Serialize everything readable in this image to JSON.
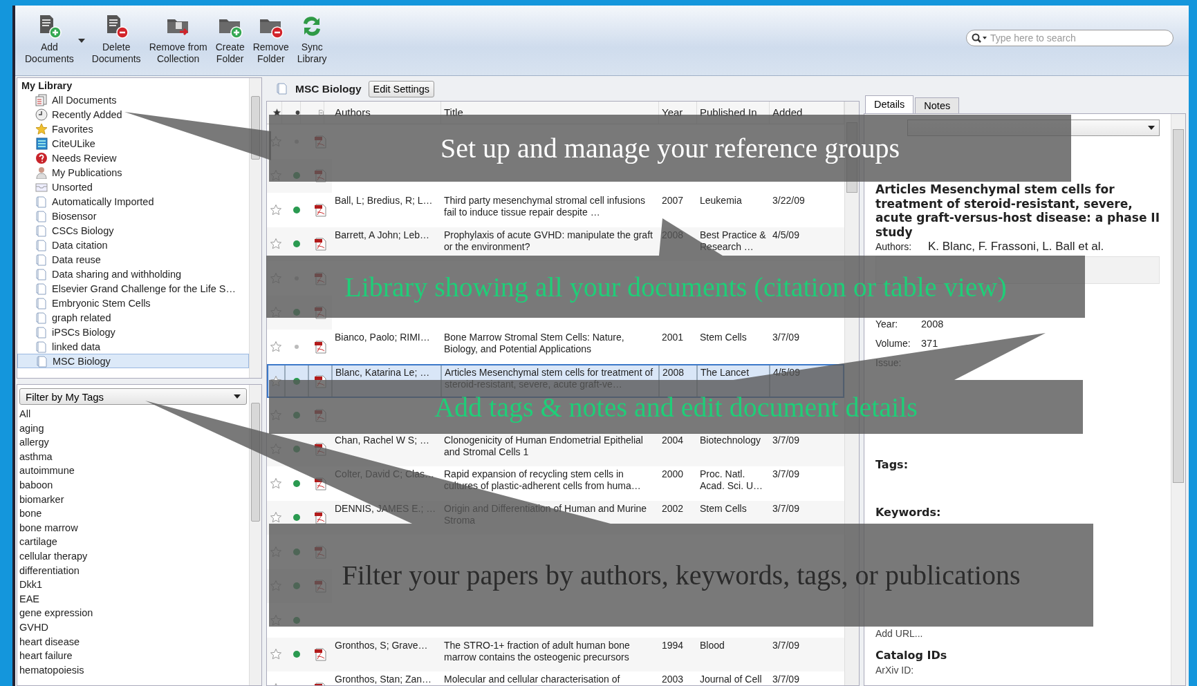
{
  "toolbar": {
    "buttons": [
      {
        "kind": "add-doc",
        "label": "Add\nDocuments",
        "has_menu": true
      },
      {
        "kind": "delete-doc",
        "label": "Delete\nDocuments",
        "has_menu": false
      },
      {
        "kind": "remove-collection",
        "label": "Remove from\nCollection",
        "has_menu": false
      },
      {
        "kind": "create-folder",
        "label": "Create\nFolder",
        "has_menu": false
      },
      {
        "kind": "remove-folder",
        "label": "Remove\nFolder",
        "has_menu": false
      },
      {
        "kind": "sync",
        "label": "Sync\nLibrary",
        "has_menu": false
      }
    ],
    "search": {
      "placeholder": "Type here to search"
    }
  },
  "library": {
    "title": "My Library",
    "items": [
      {
        "kind": "all",
        "label": "All Documents",
        "selected": false
      },
      {
        "kind": "recent",
        "label": "Recently Added",
        "selected": false
      },
      {
        "kind": "favorites",
        "label": "Favorites",
        "selected": false
      },
      {
        "kind": "citeulike",
        "label": "CiteULike",
        "selected": false
      },
      {
        "kind": "review",
        "label": "Needs Review",
        "selected": false
      },
      {
        "kind": "publications",
        "label": "My Publications",
        "selected": false
      },
      {
        "kind": "unsorted",
        "label": "Unsorted",
        "selected": false
      },
      {
        "kind": "folder",
        "label": "Automatically Imported",
        "selected": false
      },
      {
        "kind": "folder",
        "label": "Biosensor",
        "selected": false
      },
      {
        "kind": "folder",
        "label": "CSCs Biology",
        "selected": false
      },
      {
        "kind": "folder",
        "label": "Data citation",
        "selected": false
      },
      {
        "kind": "folder",
        "label": "Data reuse",
        "selected": false
      },
      {
        "kind": "folder",
        "label": "Data sharing and withholding",
        "selected": false
      },
      {
        "kind": "folder",
        "label": "Elsevier Grand Challenge for the Life S…",
        "selected": false
      },
      {
        "kind": "folder",
        "label": "Embryonic Stem Cells",
        "selected": false
      },
      {
        "kind": "folder",
        "label": "graph related",
        "selected": false
      },
      {
        "kind": "folder",
        "label": "iPSCs Biology",
        "selected": false
      },
      {
        "kind": "folder",
        "label": "linked data",
        "selected": false
      },
      {
        "kind": "folder",
        "label": "MSC Biology",
        "selected": true
      }
    ]
  },
  "tags": {
    "filter": "Filter by My Tags",
    "items": [
      "All",
      "aging",
      "allergy",
      "asthma",
      "autoimmune",
      "baboon",
      "biomarker",
      "bone",
      "bone marrow",
      "cartilage",
      "cellular therapy",
      "differentiation",
      "Dkk1",
      "EAE",
      "gene expression",
      "GVHD",
      "heart disease",
      "heart failure",
      "hematopoiesis"
    ]
  },
  "collection": {
    "title": "MSC Biology",
    "edit_button": "Edit Settings"
  },
  "table": {
    "columns": [
      "Authors",
      "Title",
      "Year",
      "Published In",
      "Added"
    ],
    "rows": [
      {
        "starred": false,
        "unread": false,
        "pdf": true,
        "selected": false
      },
      {
        "starred": false,
        "unread": true,
        "pdf": true,
        "selected": false
      },
      {
        "authors": "Ball, L; Bredius, R; L…",
        "title": "Third party mesenchymal stromal cell infusions fail to induce tissue repair despite …",
        "year": "2007",
        "published": "Leukemia",
        "added": "3/22/09",
        "starred": false,
        "unread": true,
        "pdf": true,
        "selected": false
      },
      {
        "authors": "Barrett, A John; Leb…",
        "title": "Prophylaxis of acute GVHD: manipulate the graft or the environment?",
        "year": "2008",
        "published": "Best Practice & Research …",
        "added": "4/5/09",
        "starred": false,
        "unread": true,
        "pdf": true,
        "selected": false
      },
      {
        "starred": false,
        "unread": false,
        "pdf": true,
        "selected": false
      },
      {
        "starred": false,
        "unread": true,
        "pdf": true,
        "selected": false
      },
      {
        "authors": "Bianco, Paolo; RIMI…",
        "title": "Bone Marrow Stromal Stem Cells: Nature, Biology, and Potential Applications",
        "year": "2001",
        "published": "Stem Cells",
        "added": "3/7/09",
        "starred": false,
        "unread": false,
        "pdf": true,
        "selected": false
      },
      {
        "authors": "Blanc, Katarina Le; …",
        "title": "Articles Mesenchymal stem cells for treatment of steroid-resistant, severe, acute graft-ve…",
        "year": "2008",
        "published": "The Lancet",
        "added": "4/5/09",
        "starred": false,
        "unread": true,
        "pdf": true,
        "selected": true
      },
      {
        "starred": false,
        "unread": true,
        "pdf": true,
        "selected": false
      },
      {
        "authors": "Chan, Rachel W S; …",
        "title": "Clonogenicity of Human Endometrial Epithelial and Stromal Cells 1",
        "year": "2004",
        "published": "Biotechnology",
        "added": "3/7/09",
        "starred": false,
        "unread": true,
        "pdf": true,
        "selected": false
      },
      {
        "authors": "Colter, David C; Clas…",
        "title": "Rapid expansion of recycling stem cells in cultures of plastic-adherent cells from huma…",
        "year": "2000",
        "published": "Proc. Natl. Acad. Sci. U…",
        "added": "3/7/09",
        "starred": false,
        "unread": true,
        "pdf": true,
        "selected": false
      },
      {
        "authors": "DENNIS, JAMES E.; …",
        "title": "Origin and Differentiation of Human and Murine Stroma",
        "year": "2002",
        "published": "Stem Cells",
        "added": "3/7/09",
        "starred": false,
        "unread": true,
        "pdf": true,
        "selected": false
      },
      {
        "starred": false,
        "unread": true,
        "pdf": true,
        "selected": false
      },
      {
        "starred": false,
        "unread": true,
        "pdf": true,
        "selected": false
      },
      {
        "starred": false,
        "unread": true,
        "pdf": false,
        "selected": false
      },
      {
        "authors": "Gronthos, S; Grave…",
        "title": "The STRO-1+ fraction of adult human bone marrow contains the osteogenic precursors",
        "year": "1994",
        "published": "Blood",
        "added": "3/7/09",
        "starred": false,
        "unread": true,
        "pdf": true,
        "selected": false
      },
      {
        "authors": "Gronthos, Stan; Zan…",
        "title": "Molecular and cellular characterisation of",
        "year": "2003",
        "published": "Journal of Cell",
        "added": "3/7/09",
        "starred": false,
        "unread": true,
        "pdf": true,
        "selected": false
      }
    ]
  },
  "details": {
    "tabs": [
      {
        "label": "Details",
        "selected": true
      },
      {
        "label": "Notes",
        "selected": false
      }
    ],
    "title": "Articles Mesenchymal stem cells for treatment of steroid-resistant, severe, acute graft-versus-host disease: a phase II study",
    "authors": {
      "label": "Authors:",
      "value": "K. Blanc, F. Frassoni, L. Ball et al."
    },
    "fields": [
      {
        "label": "Year:",
        "value": "2008"
      },
      {
        "label": "Volume:",
        "value": "371"
      },
      {
        "label": "Issue:"
      }
    ],
    "sections": [
      {
        "heading": "Tags:"
      },
      {
        "heading": "Keywords:"
      },
      {
        "value": "Add URL..."
      },
      {
        "heading": "Catalog IDs",
        "value": "ArXiv ID:"
      }
    ]
  },
  "callouts": [
    {
      "text": "Set up and manage your reference groups",
      "color": "#ffffff"
    },
    {
      "text": "Library showing all your documents (citation or table view)",
      "color": "#1fce78"
    },
    {
      "text": "Add tags & notes and edit document details",
      "color": "#1fce78"
    },
    {
      "text": "Filter your papers by authors, keywords, tags, or publications",
      "color": "#2b2b2b"
    }
  ]
}
